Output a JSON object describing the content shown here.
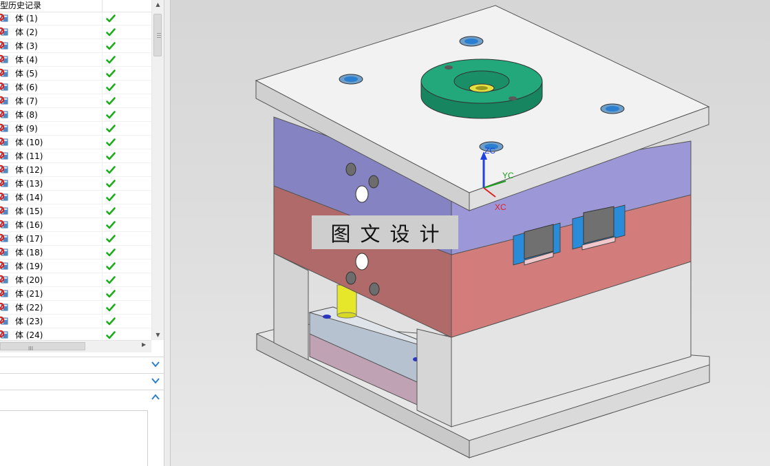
{
  "navigator": {
    "header": "型历史记录",
    "rows": [
      {
        "label": "体 (1)",
        "status": "check-icon"
      },
      {
        "label": "体 (2)",
        "status": "check-icon"
      },
      {
        "label": "体 (3)",
        "status": "check-icon"
      },
      {
        "label": "体 (4)",
        "status": "check-icon"
      },
      {
        "label": "体 (5)",
        "status": "check-icon"
      },
      {
        "label": "体 (6)",
        "status": "check-icon"
      },
      {
        "label": "体 (7)",
        "status": "check-icon"
      },
      {
        "label": "体 (8)",
        "status": "check-icon"
      },
      {
        "label": "体 (9)",
        "status": "check-icon"
      },
      {
        "label": "体 (10)",
        "status": "check-icon"
      },
      {
        "label": "体 (11)",
        "status": "check-icon"
      },
      {
        "label": "体 (12)",
        "status": "check-icon"
      },
      {
        "label": "体 (13)",
        "status": "check-icon"
      },
      {
        "label": "体 (14)",
        "status": "check-icon"
      },
      {
        "label": "体 (15)",
        "status": "check-icon"
      },
      {
        "label": "体 (16)",
        "status": "check-icon"
      },
      {
        "label": "体 (17)",
        "status": "check-icon"
      },
      {
        "label": "体 (18)",
        "status": "check-icon"
      },
      {
        "label": "体 (19)",
        "status": "check-icon"
      },
      {
        "label": "体 (20)",
        "status": "check-icon"
      },
      {
        "label": "体 (21)",
        "status": "check-icon"
      },
      {
        "label": "体 (22)",
        "status": "check-icon"
      },
      {
        "label": "体 (23)",
        "status": "check-icon"
      },
      {
        "label": "体 (24)",
        "status": "check-icon"
      }
    ],
    "hscroll_grip": "III",
    "sections": [
      {
        "name": "dependencies-panel",
        "state": "collapsed"
      },
      {
        "name": "details-panel",
        "state": "collapsed"
      },
      {
        "name": "preview-panel",
        "state": "expanded"
      }
    ]
  },
  "viewport": {
    "watermark": "图文设计",
    "axes": {
      "x": "XC",
      "y": "YC",
      "z": "ZC"
    }
  },
  "colors": {
    "top_plate": "#f2f2f2",
    "a_plate_front": "#8683c2",
    "a_plate_side": "#9b97d8",
    "b_plate_front": "#b26c6c",
    "b_plate_side": "#d17c7c",
    "ring": "#1ea374",
    "axis_x": "#e02020",
    "axis_y": "#1aa01a",
    "axis_z": "#2040e0",
    "check": "#1cab1c"
  }
}
